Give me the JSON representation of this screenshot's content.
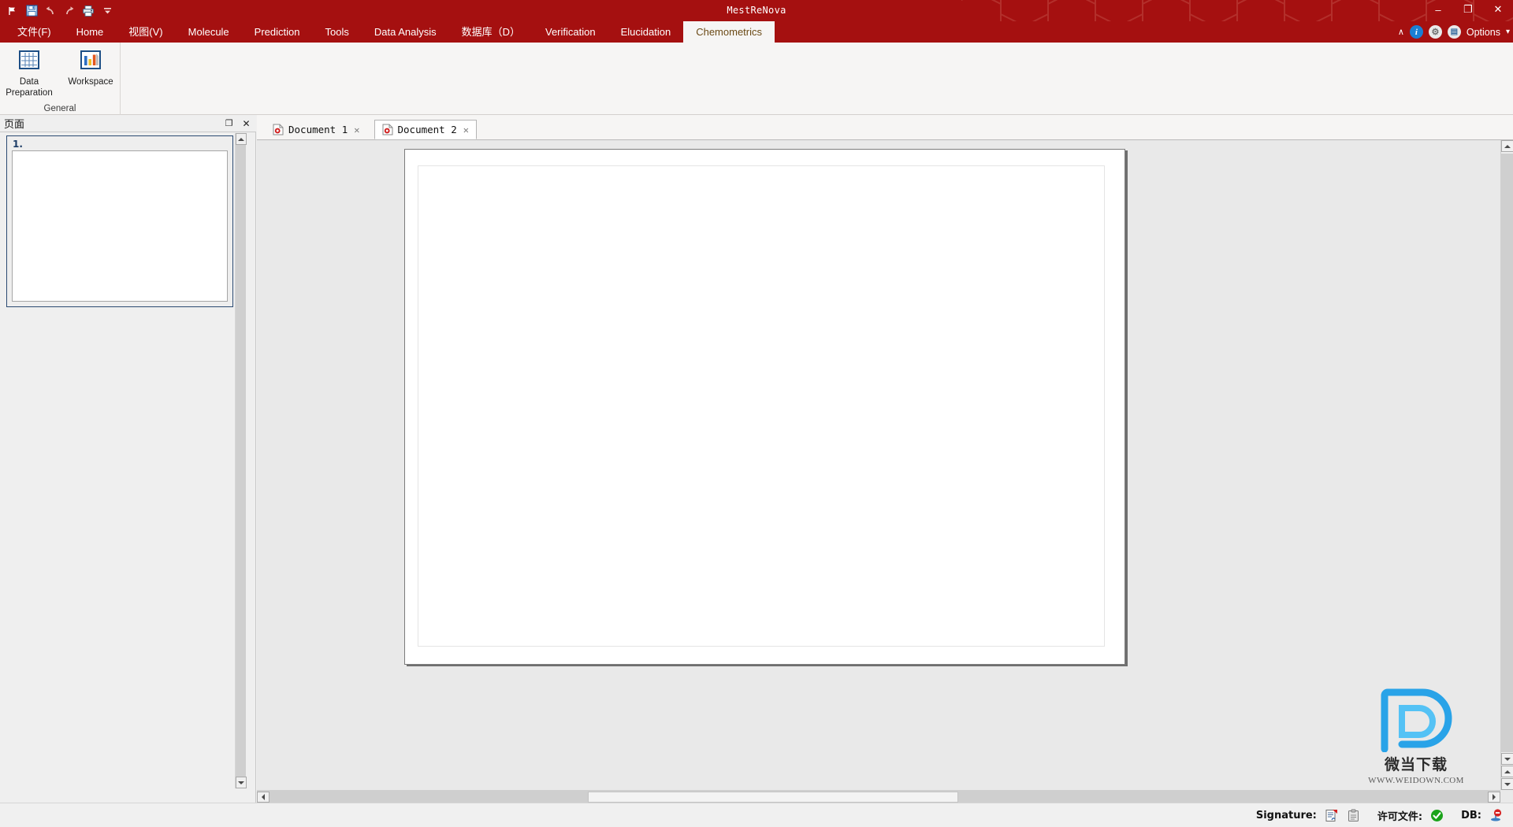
{
  "window": {
    "title": "MestReNova",
    "minimize_label": "–",
    "restore_label": "❐",
    "close_label": "✕"
  },
  "quick_access": [
    {
      "name": "mnova-flag-icon",
      "label": ""
    },
    {
      "name": "save-icon",
      "label": ""
    },
    {
      "name": "undo-icon",
      "label": ""
    },
    {
      "name": "redo-icon",
      "label": ""
    },
    {
      "name": "print-icon",
      "label": ""
    },
    {
      "name": "customize-qat-icon",
      "label": ""
    }
  ],
  "ribbon": {
    "tabs": [
      {
        "label": "文件(F)",
        "active": false
      },
      {
        "label": "Home",
        "active": false
      },
      {
        "label": "视图(V)",
        "active": false
      },
      {
        "label": "Molecule",
        "active": false
      },
      {
        "label": "Prediction",
        "active": false
      },
      {
        "label": "Tools",
        "active": false
      },
      {
        "label": "Data Analysis",
        "active": false
      },
      {
        "label": "数据库（D）",
        "active": false
      },
      {
        "label": "Verification",
        "active": false
      },
      {
        "label": "Elucidation",
        "active": false
      },
      {
        "label": "Chemometrics",
        "active": true
      }
    ],
    "right": {
      "collapse_label": "∧",
      "info_label": "i",
      "gear_label": "⚙",
      "book_label": "▤",
      "options_label": "Options",
      "options_caret": "▾"
    },
    "groups": [
      {
        "label": "General",
        "items": [
          {
            "label": "Data\nPreparation",
            "line1": "Data",
            "line2": "Preparation",
            "icon": "table-grid-icon"
          },
          {
            "label": "Workspace",
            "line1": "Workspace",
            "line2": "",
            "icon": "bar-chart-icon"
          }
        ]
      }
    ]
  },
  "dock": {
    "title": "页面",
    "float_label": "❐",
    "close_label": "✕",
    "pages": [
      {
        "number": "1."
      }
    ]
  },
  "documents": {
    "tabs": [
      {
        "label": "Document 1",
        "active": false,
        "close": "✕"
      },
      {
        "label": "Document 2",
        "active": true,
        "close": "✕"
      }
    ]
  },
  "watermark": {
    "logo_letter": "D",
    "name": "微当下载",
    "url": "WWW.WEIDOWN.COM",
    "color": "#29a3e8"
  },
  "statusbar": {
    "signature_label": "Signature:",
    "signature_icons": [
      {
        "name": "sign-document-icon"
      },
      {
        "name": "signature-clipboard-icon"
      }
    ],
    "license_label": "许可文件:",
    "license_status": "ok",
    "db_label": "DB:",
    "db_status": "disconnected"
  },
  "colors": {
    "brand_red": "#a51010",
    "ribbon_bg": "#f6f5f4",
    "accent_blue": "#1a7fd4",
    "ok_green": "#1aa31a",
    "thumb_border": "#2b4a72"
  }
}
